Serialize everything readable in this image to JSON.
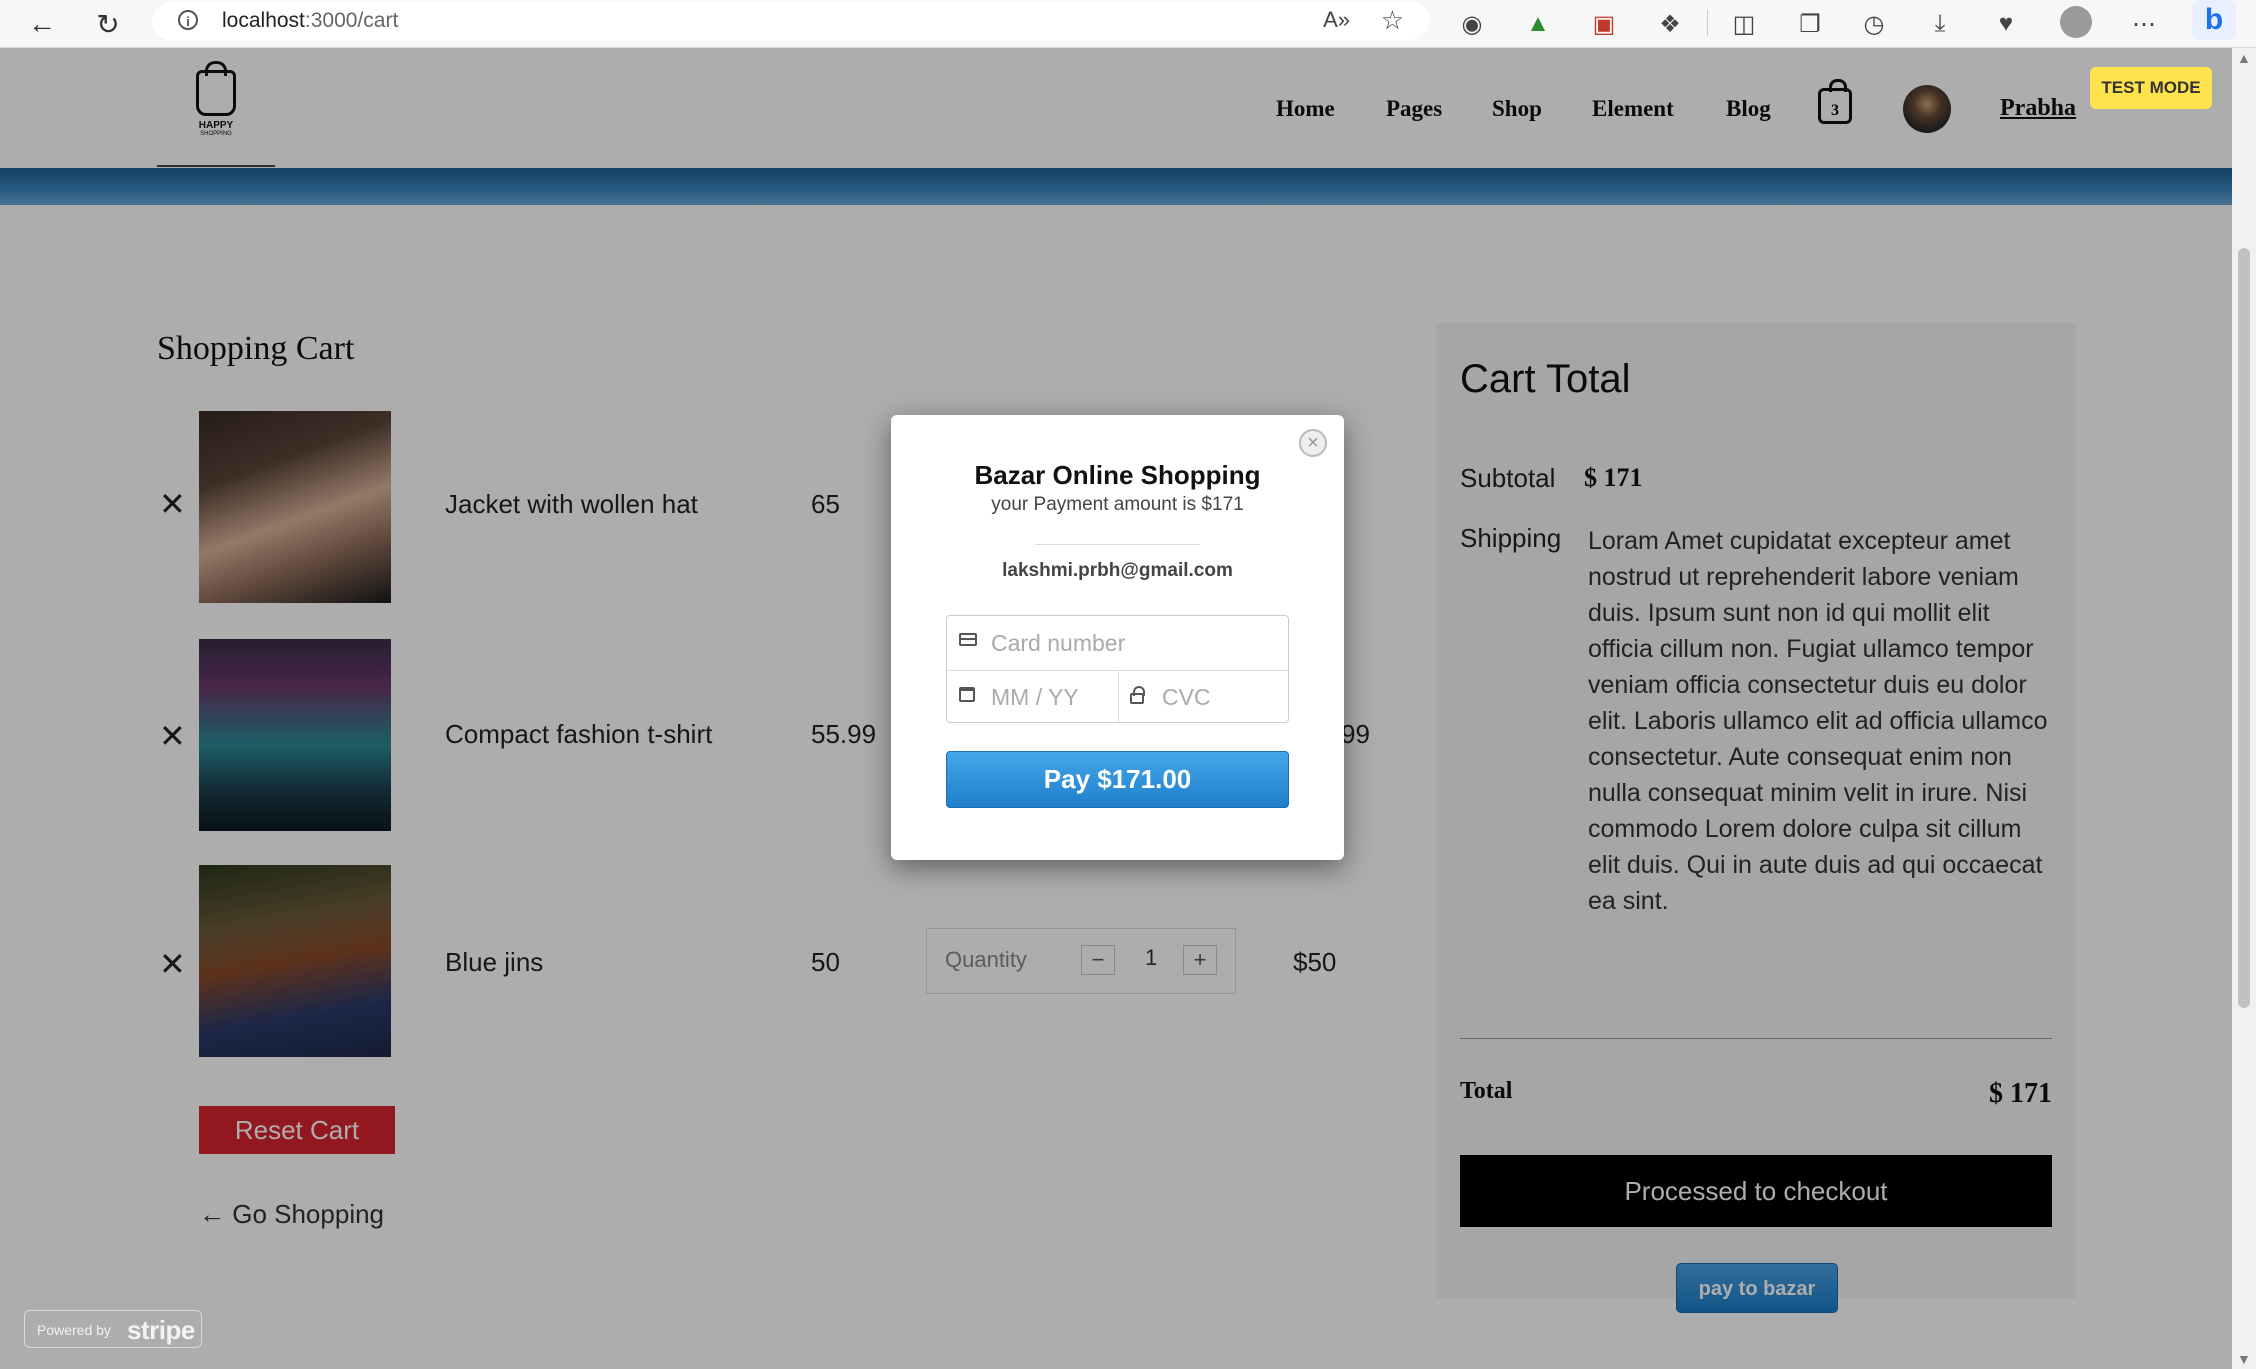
{
  "browser": {
    "url_host": "localhost",
    "url_path": ":3000/cart",
    "read_aloud_icon": "A»"
  },
  "header": {
    "logo_line1": "HAPPY",
    "logo_line2": "SHOPPING",
    "menu": [
      "Home",
      "Pages",
      "Shop",
      "Element",
      "Blog"
    ],
    "cart_count": "3",
    "user_name": "Prabha"
  },
  "cart": {
    "title": "Shopping Cart",
    "items": [
      {
        "name": "Jacket with wollen hat",
        "price": "65",
        "total": ""
      },
      {
        "name": "Compact fashion t-shirt",
        "price": "55.99",
        "total": "99"
      },
      {
        "name": "Blue jins",
        "price": "50",
        "quantity_label": "Quantity",
        "quantity": "1",
        "minus": "−",
        "plus": "+",
        "total": "$50"
      }
    ],
    "remove_glyph": "✕",
    "reset_label": "Reset Cart",
    "go_shopping_label": "← Go Shopping"
  },
  "totals": {
    "title": "Cart Total",
    "subtotal_label": "Subtotal",
    "subtotal_value": "$ 171",
    "shipping_label": "Shipping",
    "shipping_text": "Loram Amet cupidatat excepteur amet nostrud ut reprehenderit labore veniam duis. Ipsum sunt non id qui mollit elit officia cillum non. Fugiat ullamco tempor veniam officia consectetur duis eu dolor elit. Laboris ullamco elit ad officia ullamco consectetur. Aute consequat enim non nulla consequat minim velit in irure. Nisi commodo Lorem dolore culpa sit cillum elit duis. Qui in aute duis ad qui occaecat ea sint.",
    "total_label": "Total",
    "total_value": "$ 171",
    "checkout_label": "Processed to checkout",
    "pay_bazar_label": "pay to bazar"
  },
  "stripe": {
    "test_mode_label": "TEST MODE",
    "powered_by": "Powered by",
    "stripe_word": "stripe",
    "modal_title": "Bazar Online Shopping",
    "modal_subtitle": "your Payment amount is $171",
    "email": "lakshmi.prbh@gmail.com",
    "card_placeholder": "Card number",
    "expiry_placeholder": "MM / YY",
    "cvc_placeholder": "CVC",
    "pay_label": "Pay $171.00",
    "close_glyph": "×"
  },
  "colors": {
    "reset_red": "#d9232d",
    "stripe_blue": "#1f7fcb",
    "test_mode_yellow": "#ffe34d"
  }
}
